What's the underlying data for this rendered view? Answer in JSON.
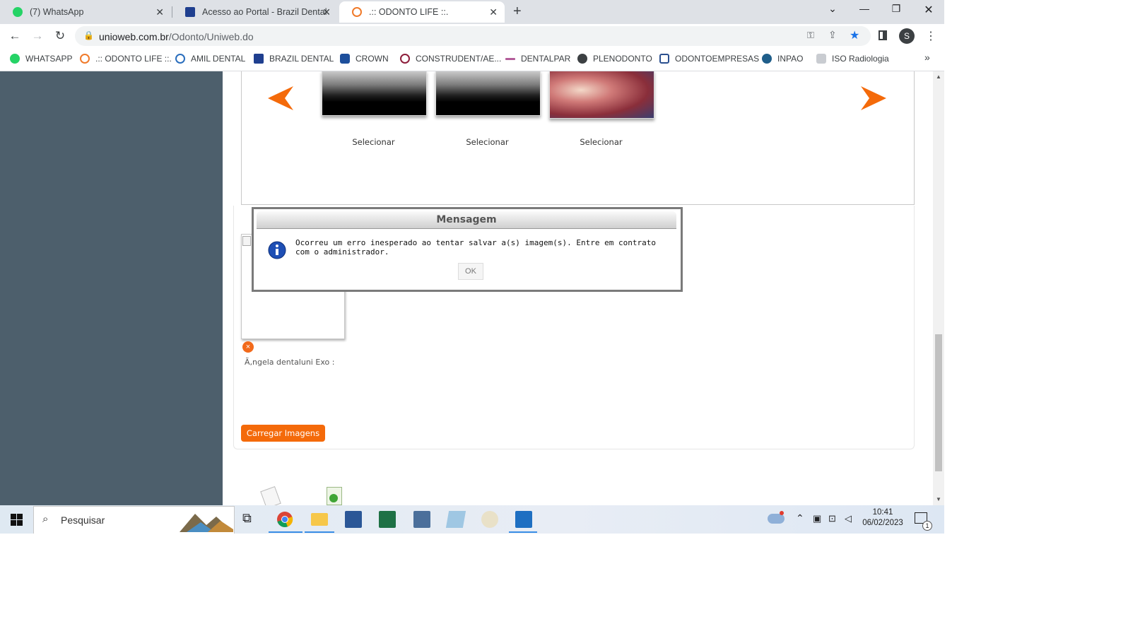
{
  "browser": {
    "tabs": [
      {
        "title": "(7) WhatsApp",
        "active": false
      },
      {
        "title": "Acesso ao Portal - Brazil Dental",
        "active": false
      },
      {
        "title": ".:: ODONTO LIFE ::.",
        "active": true
      }
    ],
    "new_tab": "+",
    "url_domain": "unioweb.com.br",
    "url_path": "/Odonto/Uniweb.do",
    "profile_initial": "S",
    "bookmarks": [
      "WHATSAPP",
      ".:: ODONTO LIFE ::.",
      "AMIL DENTAL",
      "BRAZIL DENTAL",
      "CROWN",
      "CONSTRUDENT/AE...",
      "DENTALPAR",
      "PLENODONTO",
      "ODONTOEMPRESAS",
      "INPAO",
      "ISO Radiologia"
    ],
    "bookmarks_more": "»"
  },
  "page": {
    "gallery": {
      "select_labels": [
        "Selecionar",
        "Selecionar",
        "Selecionar"
      ]
    },
    "caption": "Ã‚ngela dentaluni Exo :",
    "upload_button": "Carregar Imagens",
    "remove_icon": "×"
  },
  "dialog": {
    "title": "Mensagem",
    "message": "Ocorreu um erro inesperado ao tentar salvar a(s) imagem(s). Entre em contrato com o administrador.",
    "ok_label": "OK"
  },
  "taskbar": {
    "search_placeholder": "Pesquisar",
    "time": "10:41",
    "date": "06/02/2023",
    "notification_count": "1"
  },
  "colors": {
    "accent_orange": "#f46a0a",
    "sidebar": "#4d5f6c",
    "tab_bar": "#dee1e6",
    "star_blue": "#1a73e8"
  }
}
